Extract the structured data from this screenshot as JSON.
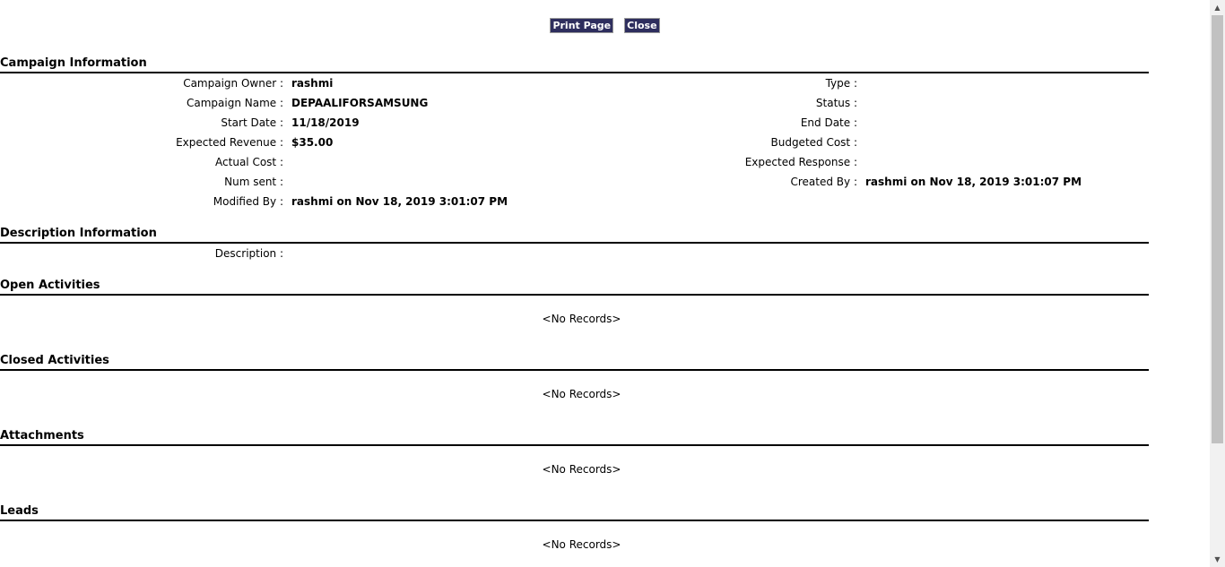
{
  "toolbar": {
    "print_label": "Print Page",
    "close_label": "Close"
  },
  "campaign_info": {
    "title": "Campaign Information",
    "owner_label": "Campaign Owner :",
    "owner_value": "rashmi",
    "type_label": "Type :",
    "type_value": "",
    "name_label": "Campaign Name :",
    "name_value": "DEPAALIFORSAMSUNG",
    "status_label": "Status :",
    "status_value": "",
    "start_label": "Start Date :",
    "start_value": "11/18/2019",
    "end_label": "End Date :",
    "end_value": "",
    "exp_revenue_label": "Expected Revenue :",
    "exp_revenue_value": "$35.00",
    "budgeted_label": "Budgeted Cost :",
    "budgeted_value": "",
    "actual_label": "Actual Cost :",
    "actual_value": "",
    "exp_response_label": "Expected Response :",
    "exp_response_value": "",
    "num_sent_label": "Num sent :",
    "num_sent_value": "",
    "created_label": "Created By :",
    "created_value": "rashmi on Nov 18, 2019 3:01:07 PM",
    "modified_label": "Modified By :",
    "modified_value": "rashmi on Nov 18, 2019 3:01:07 PM"
  },
  "description_info": {
    "title": "Description Information",
    "desc_label": "Description :",
    "desc_value": ""
  },
  "open_activities": {
    "title": "Open Activities",
    "empty": "<No Records>"
  },
  "closed_activities": {
    "title": "Closed Activities",
    "empty": "<No Records>"
  },
  "attachments": {
    "title": "Attachments",
    "empty": "<No Records>"
  },
  "leads": {
    "title": "Leads",
    "empty": "<No Records>"
  },
  "colors": {
    "button_bg": "#2e2e5e",
    "rule": "#000000"
  },
  "icons": {
    "scroll_up": "chevron-up-icon",
    "scroll_down": "chevron-down-icon"
  }
}
